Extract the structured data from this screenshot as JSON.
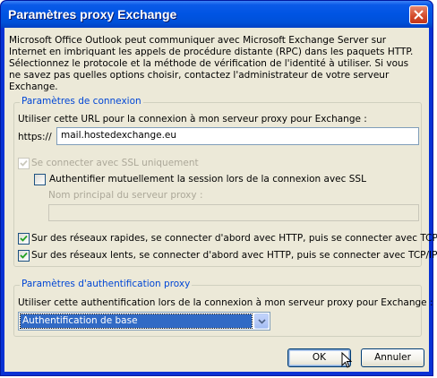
{
  "window": {
    "title": "Paramètres proxy Exchange"
  },
  "intro": "Microsoft Office Outlook peut communiquer avec Microsoft Exchange Server sur Internet en imbriquant les appels de procédure distante (RPC) dans les paquets HTTP. Sélectionnez le protocole et la méthode de vérification de l'identité à utiliser. Si vous ne savez pas quelles options choisir, contactez l'administrateur de votre serveur Exchange.",
  "connection": {
    "legend": "Paramètres de connexion",
    "url_label": "Utiliser cette URL pour la connexion à mon serveur proxy pour Exchange :",
    "url_prefix": "https://",
    "url_value": "mail.hostedexchange.eu",
    "ssl_only_label": "Se connecter avec SSL uniquement",
    "ssl_only_checked": true,
    "mutual_auth_label": "Authentifier mutuellement la session lors de la connexion avec SSL",
    "mutual_auth_checked": false,
    "principal_label": "Nom principal du serveur proxy :",
    "principal_value": "",
    "fast_networks_label": "Sur des réseaux rapides, se connecter d'abord avec HTTP, puis se connecter avec TCP/IP",
    "fast_networks_checked": true,
    "slow_networks_label": "Sur des réseaux lents, se connecter d'abord avec HTTP, puis se connecter avec TCP/IP",
    "slow_networks_checked": true
  },
  "auth": {
    "legend": "Paramètres d'authentification proxy",
    "label": "Utiliser cette authentification lors de la connexion à mon serveur proxy pour Exchange :",
    "selected": "Authentification de base"
  },
  "buttons": {
    "ok": "OK",
    "cancel": "Annuler"
  },
  "colors": {
    "titlebar": "#0054e3",
    "dialog_bg": "#ece9d8",
    "legend_text": "#0046d5",
    "selection": "#316ac5"
  }
}
